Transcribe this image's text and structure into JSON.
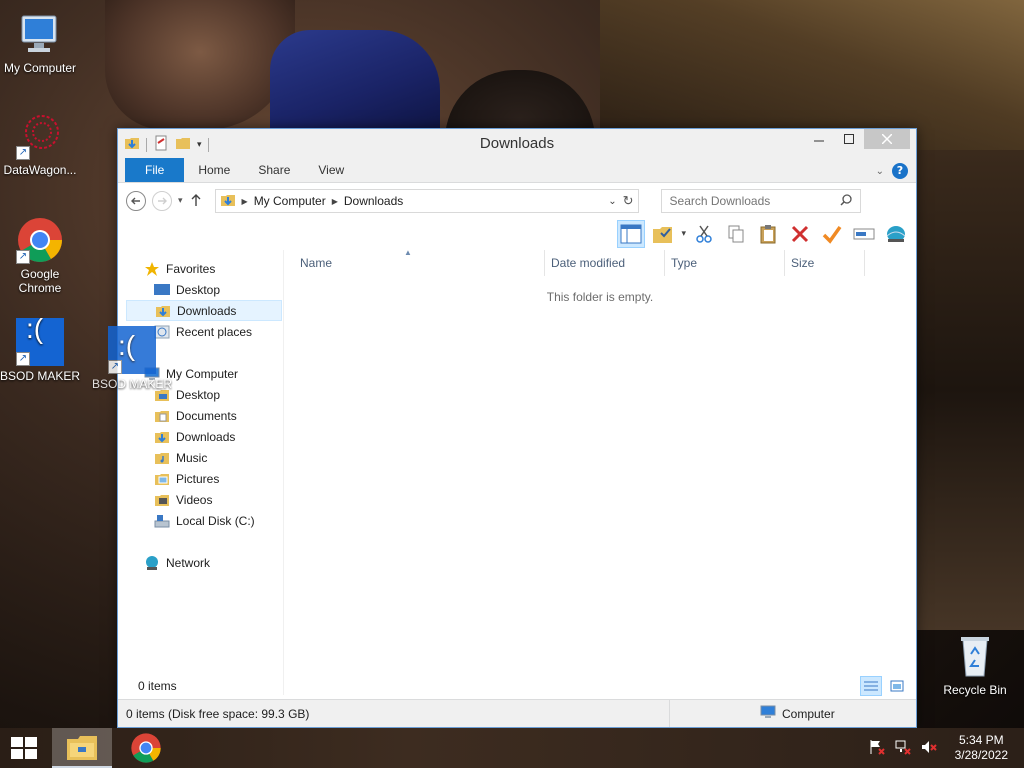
{
  "desktop": {
    "icons": [
      {
        "label": "My Computer"
      },
      {
        "label": "DataWagon..."
      },
      {
        "label": "Google Chrome"
      },
      {
        "label": "BSOD MAKER"
      },
      {
        "label": "Recycle Bin"
      }
    ],
    "drag_ghost_label": "BSOD MAKER",
    "bsod_face": ":("
  },
  "window": {
    "title": "Downloads",
    "ribbon_tabs": [
      "File",
      "Home",
      "Share",
      "View"
    ],
    "address": {
      "segments": [
        "My Computer",
        "Downloads"
      ]
    },
    "search": {
      "placeholder": "Search Downloads"
    },
    "nav_pane": {
      "favorites": {
        "label": "Favorites",
        "items": [
          "Desktop",
          "Downloads",
          "Recent places"
        ]
      },
      "computer": {
        "label": "My Computer",
        "items": [
          "Desktop",
          "Documents",
          "Downloads",
          "Music",
          "Pictures",
          "Videos",
          "Local Disk (C:)"
        ]
      },
      "network": {
        "label": "Network"
      }
    },
    "columns": [
      "Name",
      "Date modified",
      "Type",
      "Size"
    ],
    "empty_message": "This folder is empty.",
    "item_count": "0 items",
    "status_detail": "0 items (Disk free space: 99.3 GB)",
    "status_location": "Computer"
  },
  "taskbar": {
    "time": "5:34 PM",
    "date": "3/28/2022"
  },
  "colors": {
    "file_tab": "#1979ca",
    "selection": "#cce8ff",
    "bsod_blue": "#1464d2"
  }
}
